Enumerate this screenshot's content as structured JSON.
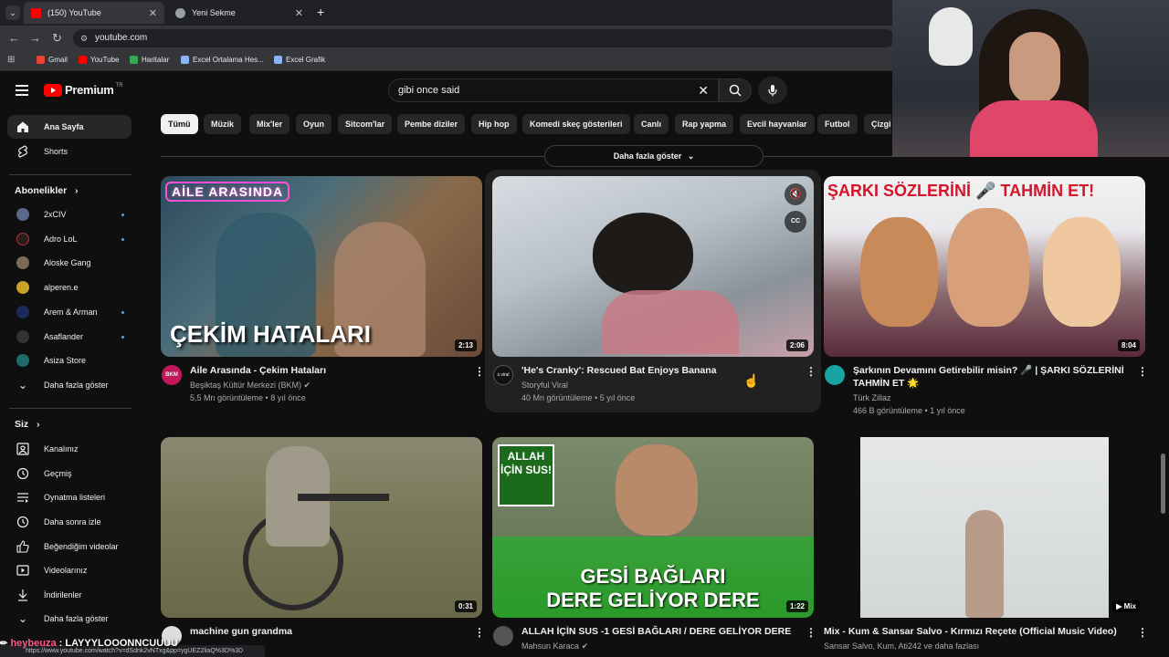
{
  "browser": {
    "tabs": [
      {
        "title": "(150) YouTube",
        "active": true
      },
      {
        "title": "Yeni Sekme",
        "active": false
      }
    ],
    "url": "youtube.com",
    "bookmarks": [
      "Gmail",
      "YouTube",
      "Haritalar",
      "Excel Ortalama Hes...",
      "Excel Grafik"
    ],
    "status_url": "https://www.youtube.com/watch?v=dSdnk2vNTxg&pp=ygUEZ2liaQ%3D%3D"
  },
  "masthead": {
    "logo_text": "Premium",
    "logo_badge": "TR",
    "search_value": "gibi once said"
  },
  "sidebar": {
    "main": [
      {
        "label": "Ana Sayfa",
        "icon": "home-icon",
        "active": true
      },
      {
        "label": "Shorts",
        "icon": "shorts-icon",
        "active": false
      }
    ],
    "subscriptions_header": "Abonelikler",
    "subscriptions": [
      {
        "label": "2xCIV",
        "color": "#5a6a8a",
        "dot": true
      },
      {
        "label": "Adro LoL",
        "color": "#2b1d1d",
        "dot": true
      },
      {
        "label": "Aloske Gang",
        "color": "#7a6a5a",
        "dot": false
      },
      {
        "label": "alperen.e",
        "color": "#c9a227",
        "dot": false
      },
      {
        "label": "Arem & Arman",
        "color": "#1c2a5a",
        "dot": true
      },
      {
        "label": "Asaflander",
        "color": "#333333",
        "dot": true
      },
      {
        "label": "Asiza Store",
        "color": "#1f6a6a",
        "dot": false
      }
    ],
    "subscriptions_more": "Daha fazla göster",
    "you_header": "Siz",
    "you_items": [
      {
        "label": "Kanalınız",
        "icon": "channel-icon"
      },
      {
        "label": "Geçmiş",
        "icon": "history-icon"
      },
      {
        "label": "Oynatma listeleri",
        "icon": "playlists-icon"
      },
      {
        "label": "Daha sonra izle",
        "icon": "watch-later-icon"
      },
      {
        "label": "Beğendiğim videolar",
        "icon": "like-icon"
      },
      {
        "label": "Videolarınız",
        "icon": "your-videos-icon"
      },
      {
        "label": "İndirilenler",
        "icon": "download-icon"
      },
      {
        "label": "Daha fazla göster",
        "icon": "chevron-down-icon"
      }
    ]
  },
  "chips": [
    "Tümü",
    "Müzik",
    "Mix'ler",
    "Oyun",
    "Sitcom'lar",
    "Pembe diziler",
    "Hip hop",
    "Komedi skeç gösterileri",
    "Canlı",
    "Rap yapma",
    "Evcil hayvanlar",
    "Futbol",
    "Çizgi"
  ],
  "show_more": "Daha fazla göster",
  "videos": [
    {
      "title": "Aile Arasında - Çekim Hataları",
      "channel": "Beşiktaş Kültür Merkezi (BKM)",
      "verified": true,
      "stats": "5,5 Mn görüntüleme • 8 yıl önce",
      "duration": "2:13",
      "thumb_text": "ÇEKİM HATALARI",
      "thumb_badge": "AİLE ARASINDA",
      "avatar_text": "BKM"
    },
    {
      "title": "'He's Cranky': Rescued Bat Enjoys Banana",
      "channel": "Storyful Viral",
      "verified": false,
      "stats": "40 Mn görüntüleme • 5 yıl önce",
      "duration": "2:06",
      "thumb_text": "",
      "thumb_badge": "",
      "avatar_text": "s.viral"
    },
    {
      "title": "Şarkının Devamını Getirebilir misin? 🎤 | ŞARKI SÖZLERİNİ TAHMİN ET 🌟",
      "channel": "Türk Zillaz",
      "verified": false,
      "stats": "466 B görüntüleme • 1 yıl önce",
      "duration": "8:04",
      "thumb_text": "ŞARKI SÖZLERİNİ 🎤 TAHMİN ET!",
      "thumb_badge": "",
      "avatar_text": ""
    },
    {
      "title": "machine gun grandma",
      "channel": "",
      "verified": false,
      "stats": "",
      "duration": "0:31",
      "thumb_text": "",
      "thumb_badge": "",
      "avatar_text": ""
    },
    {
      "title": "ALLAH İÇİN SUS -1 GESİ BAĞLARI / DERE GELİYOR DERE",
      "channel": "Mahsun Karaca",
      "verified": true,
      "stats": "",
      "duration": "1:22",
      "thumb_text": "GESİ BAĞLARI\nDERE GELİYOR DERE",
      "thumb_badge": "ALLAH İÇİN SUS!",
      "avatar_text": ""
    },
    {
      "title": "Mix - Kum & Sansar Salvo - Kırmızı Reçete (Official Music Video)",
      "channel": "Sansar Salvo, Kum, Ati242 ve daha fazlası",
      "verified": false,
      "stats": "",
      "duration": "Mix",
      "thumb_text": "",
      "thumb_badge": "",
      "avatar_text": ""
    }
  ],
  "chat_overlay": ": LAYYYLOOONNCUUUU",
  "chat_user": "heybeuza",
  "colors": {
    "youtube_red": "#ff0000",
    "background": "#0f0f0f",
    "chip_bg": "#272727",
    "link_blue": "#3ea6ff"
  }
}
